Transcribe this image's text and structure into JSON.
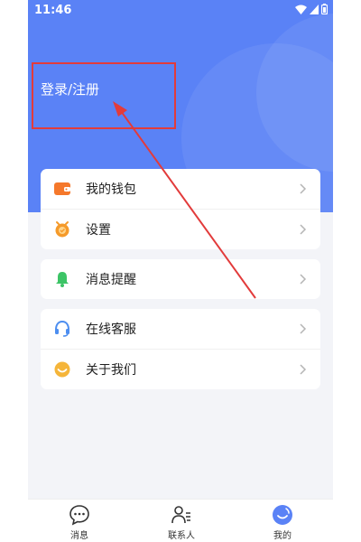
{
  "status_bar": {
    "time": "11:46"
  },
  "header": {
    "login_text": "登录/注册"
  },
  "menu": {
    "group1": [
      {
        "label": "我的钱包",
        "icon": "wallet-icon"
      },
      {
        "label": "设置",
        "icon": "settings-icon"
      }
    ],
    "group2": [
      {
        "label": "消息提醒",
        "icon": "bell-icon"
      }
    ],
    "group3": [
      {
        "label": "在线客服",
        "icon": "headset-icon"
      },
      {
        "label": "关于我们",
        "icon": "smile-icon"
      }
    ]
  },
  "tabbar": {
    "tabs": [
      {
        "label": "消息",
        "icon": "chat-bubble-icon"
      },
      {
        "label": "联系人",
        "icon": "contacts-icon"
      },
      {
        "label": "我的",
        "icon": "profile-icon"
      }
    ]
  },
  "colors": {
    "header_bg": "#5a82f6",
    "annotation_red": "#e23b3b",
    "wallet": "#f5782b",
    "settings": "#f59a2a",
    "bell": "#3cc466",
    "headset": "#4d8ef0",
    "smile": "#f5b53a"
  }
}
